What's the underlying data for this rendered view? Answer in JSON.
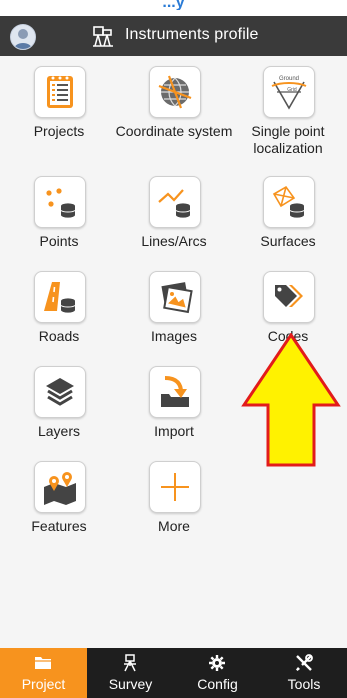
{
  "top_strip": "...y",
  "header": {
    "title": "Instruments profile",
    "avatar": "avatar-icon",
    "profile_icon": "instruments-icon"
  },
  "tiles": [
    {
      "label": "Projects",
      "icon": "projects-icon"
    },
    {
      "label": "Coordinate system",
      "icon": "coordinate-system-icon"
    },
    {
      "label": "Single point localization",
      "icon": "localization-icon",
      "icon_text_top": "Ground",
      "icon_text_bottom": "Grid"
    },
    {
      "label": "Points",
      "icon": "points-icon"
    },
    {
      "label": "Lines/Arcs",
      "icon": "lines-arcs-icon"
    },
    {
      "label": "Surfaces",
      "icon": "surfaces-icon"
    },
    {
      "label": "Roads",
      "icon": "roads-icon"
    },
    {
      "label": "Images",
      "icon": "images-icon"
    },
    {
      "label": "Codes",
      "icon": "codes-icon"
    },
    {
      "label": "Layers",
      "icon": "layers-icon"
    },
    {
      "label": "Import",
      "icon": "import-icon"
    },
    {
      "label": "Features",
      "icon": "features-icon"
    },
    {
      "label": "More",
      "icon": "plus-icon"
    }
  ],
  "annotation": {
    "type": "highlight-arrow",
    "target": "Codes",
    "fill": "#fff200",
    "stroke": "#e21b1b"
  },
  "nav": [
    {
      "label": "Project",
      "icon": "folder-icon",
      "active": true
    },
    {
      "label": "Survey",
      "icon": "survey-icon",
      "active": false
    },
    {
      "label": "Config",
      "icon": "gear-icon",
      "active": false
    },
    {
      "label": "Tools",
      "icon": "tools-icon",
      "active": false
    }
  ],
  "colors": {
    "accent": "#f7931e",
    "header": "#3a3a3a",
    "navbar": "#1e1e1e",
    "background": "#f5f5f5"
  }
}
